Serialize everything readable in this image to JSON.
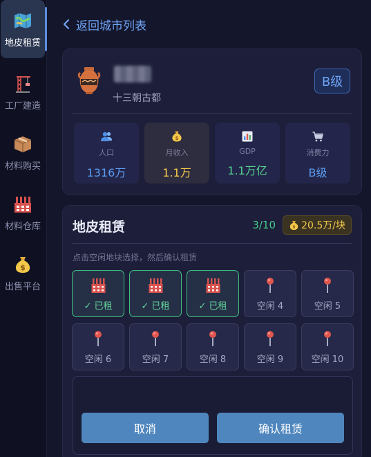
{
  "sidebar": {
    "items": [
      {
        "label": "地皮租赁",
        "icon": "map-icon",
        "active": true
      },
      {
        "label": "工厂建造",
        "icon": "crane-icon",
        "active": false
      },
      {
        "label": "材料购买",
        "icon": "box-icon",
        "active": false
      },
      {
        "label": "材料仓库",
        "icon": "factory-icon",
        "active": false
      },
      {
        "label": "出售平台",
        "icon": "money-bag-icon",
        "active": false
      }
    ]
  },
  "header": {
    "back_label": "返回城市列表"
  },
  "city": {
    "subtitle": "十三朝古都",
    "grade": "B级",
    "stats": [
      {
        "label": "人口",
        "value": "1316万",
        "icon": "people-icon",
        "color": "#5b9bf0"
      },
      {
        "label": "月收入",
        "value": "1.1万",
        "icon": "money-bag-icon",
        "color": "#f3c84a"
      },
      {
        "label": "GDP",
        "value": "1.1万亿",
        "icon": "bar-chart-icon",
        "color": "#54d08e"
      },
      {
        "label": "消费力",
        "value": "B级",
        "icon": "cart-icon",
        "color": "#5b9bf0"
      }
    ]
  },
  "lease": {
    "title": "地皮租赁",
    "count": "3/10",
    "price": "20.5万/块",
    "hint": "点击空闲地块选择，然后确认租赁",
    "plots": [
      {
        "label": "✓ 已租",
        "status": "rented"
      },
      {
        "label": "✓ 已租",
        "status": "rented"
      },
      {
        "label": "✓ 已租",
        "status": "rented"
      },
      {
        "label": "空闲 4",
        "status": "free"
      },
      {
        "label": "空闲 5",
        "status": "free"
      },
      {
        "label": "空闲 6",
        "status": "free"
      },
      {
        "label": "空闲 7",
        "status": "free"
      },
      {
        "label": "空闲 8",
        "status": "free"
      },
      {
        "label": "空闲 9",
        "status": "free"
      },
      {
        "label": "空闲 10",
        "status": "free"
      }
    ],
    "cancel_label": "取消",
    "confirm_label": "确认租赁"
  },
  "colors": {
    "accent": "#6ea3f5",
    "rented": "#3fc27f",
    "gold": "#f3c84a",
    "button": "#4f86bd"
  }
}
